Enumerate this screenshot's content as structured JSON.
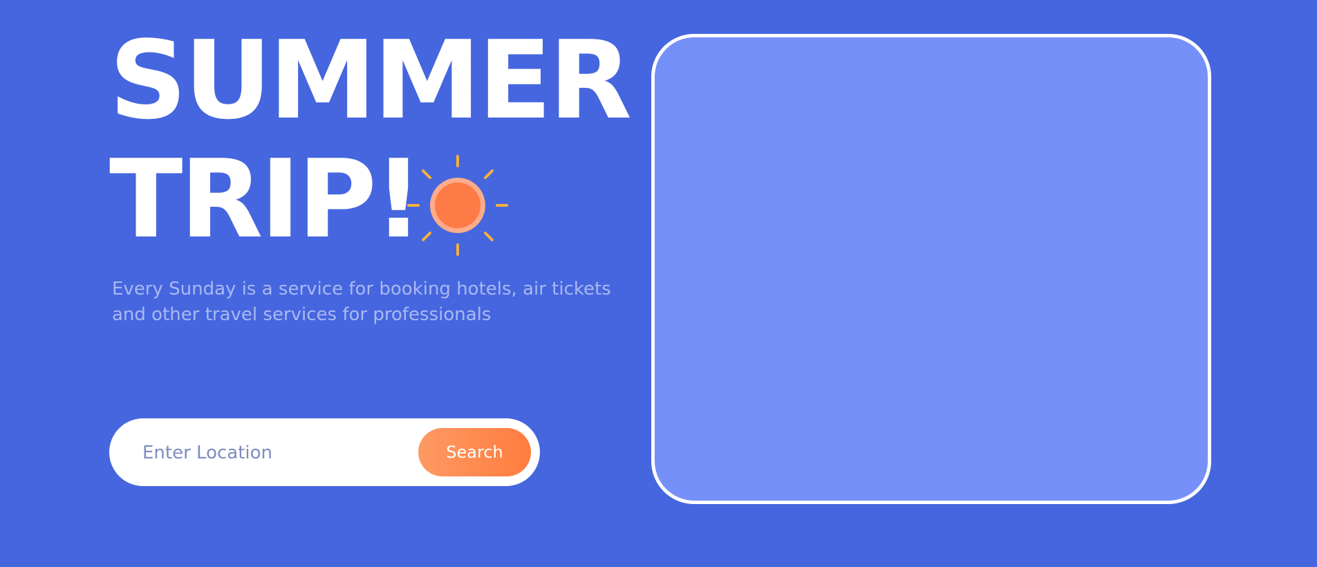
{
  "hero": {
    "title_line1": "SUMMER",
    "title_line2": "TRIP!",
    "subtitle_line1": "Every Sunday is a service for booking hotels, air tickets",
    "subtitle_line2": "and other travel services for professionals",
    "sun_icon": "sun-icon"
  },
  "search": {
    "placeholder": "Enter Location",
    "value": "",
    "button_label": "Search"
  },
  "colors": {
    "background": "#4566de",
    "accent": "#ff7c3e",
    "sun_core": "#fe7a46",
    "sun_ring": "#fcac8a",
    "sun_rays": "#f7b13c",
    "image_placeholder": "#7690f9",
    "subtitle": "#aab8f3"
  }
}
